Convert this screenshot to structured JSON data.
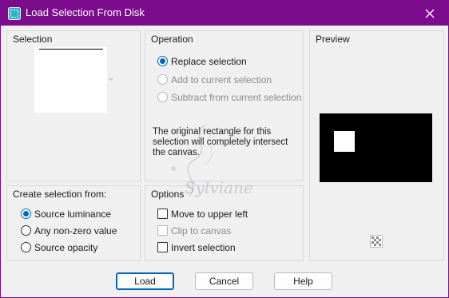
{
  "window": {
    "title": "Load Selection From Disk",
    "title_bar_color": "#7b0c8c",
    "app_icon": "selection-disk-icon",
    "close_icon": "close-icon"
  },
  "selection_panel": {
    "title": "Selection"
  },
  "operation_panel": {
    "title": "Operation",
    "options": [
      {
        "label": "Replace selection",
        "selected": true,
        "enabled": true
      },
      {
        "label": "Add to current selection",
        "selected": false,
        "enabled": false
      },
      {
        "label": "Subtract from current selection",
        "selected": false,
        "enabled": false
      }
    ],
    "info_text": "The original rectangle for this selection will completely intersect the canvas."
  },
  "preview_panel": {
    "title": "Preview",
    "checker_icon": "transparency-checker-icon"
  },
  "create_from_panel": {
    "title": "Create selection from:",
    "options": [
      {
        "label": "Source luminance",
        "selected": true
      },
      {
        "label": "Any non-zero value",
        "selected": false
      },
      {
        "label": "Source opacity",
        "selected": false
      }
    ]
  },
  "options_panel": {
    "title": "Options",
    "checkboxes": [
      {
        "label": "Move to upper left",
        "checked": false,
        "enabled": true
      },
      {
        "label": "Clip to canvas",
        "checked": false,
        "enabled": false
      },
      {
        "label": "Invert selection",
        "checked": false,
        "enabled": true
      }
    ]
  },
  "buttons": {
    "load": "Load",
    "cancel": "Cancel",
    "help": "Help"
  },
  "watermark": {
    "text": "Sylviane"
  },
  "colors": {
    "accent": "#0067c0",
    "dialog_bg": "#f0f0f0"
  }
}
